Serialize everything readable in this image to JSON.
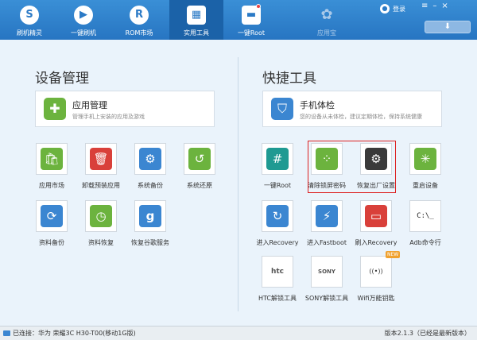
{
  "nav": {
    "items": [
      {
        "label": "刷机精灵",
        "icon": "S"
      },
      {
        "label": "一键刷机",
        "icon": "▶"
      },
      {
        "label": "ROM市场",
        "icon": "R"
      },
      {
        "label": "实用工具",
        "icon": "▦"
      },
      {
        "label": "一键Root",
        "icon": "▬"
      },
      {
        "label": "应用宝",
        "icon": "✿"
      }
    ],
    "login_label": "登录",
    "download_icon": "⬇"
  },
  "device_management": {
    "title": "设备管理",
    "card": {
      "title": "应用管理",
      "desc": "管理手机上安装的应用及游戏",
      "icon": "puzzle-icon"
    },
    "tiles": [
      {
        "label": "应用市场",
        "glyph": "🛍"
      },
      {
        "label": "卸载预装应用",
        "glyph": "🗑"
      },
      {
        "label": "系统备份",
        "glyph": "⚙"
      },
      {
        "label": "系统还原",
        "glyph": "↺"
      },
      {
        "label": "资料备份",
        "glyph": "⟳"
      },
      {
        "label": "资料恢复",
        "glyph": "◷"
      },
      {
        "label": "恢复谷歌服务",
        "glyph": "g"
      }
    ]
  },
  "quick_tools": {
    "title": "快捷工具",
    "card": {
      "title": "手机体检",
      "desc": "您的设备从未体检，建议定期体检，保持系统健康",
      "icon": "shield-icon"
    },
    "tiles": [
      {
        "label": "一键Root",
        "glyph": "#"
      },
      {
        "label": "清除锁屏密码",
        "glyph": "⁘"
      },
      {
        "label": "恢复出厂设置",
        "glyph": "⚙"
      },
      {
        "label": "重启设备",
        "glyph": "✳"
      },
      {
        "label": "进入Recovery",
        "glyph": "↻"
      },
      {
        "label": "进入Fastboot",
        "glyph": "⚡"
      },
      {
        "label": "刷入Recovery",
        "glyph": "▭"
      },
      {
        "label": "Adb命令行",
        "glyph": "C:\\_"
      },
      {
        "label": "HTC解锁工具",
        "glyph": "htc"
      },
      {
        "label": "SONY解锁工具",
        "glyph": "SONY"
      },
      {
        "label": "Wifi万能钥匙",
        "glyph": "((•))",
        "badge": "NEW"
      }
    ]
  },
  "status": {
    "connection": "已连接：华为 荣耀3C H30-T00(移动1G版)",
    "version": "版本2.1.3（已经是最新版本）"
  },
  "colors": {
    "toolbar": "#2b7ac6",
    "green": "#6cb33e",
    "red": "#d9403a",
    "blue": "#3b86d1",
    "teal": "#1f9a92",
    "dark": "#3a3a3a",
    "highlight": "#dd2222"
  }
}
